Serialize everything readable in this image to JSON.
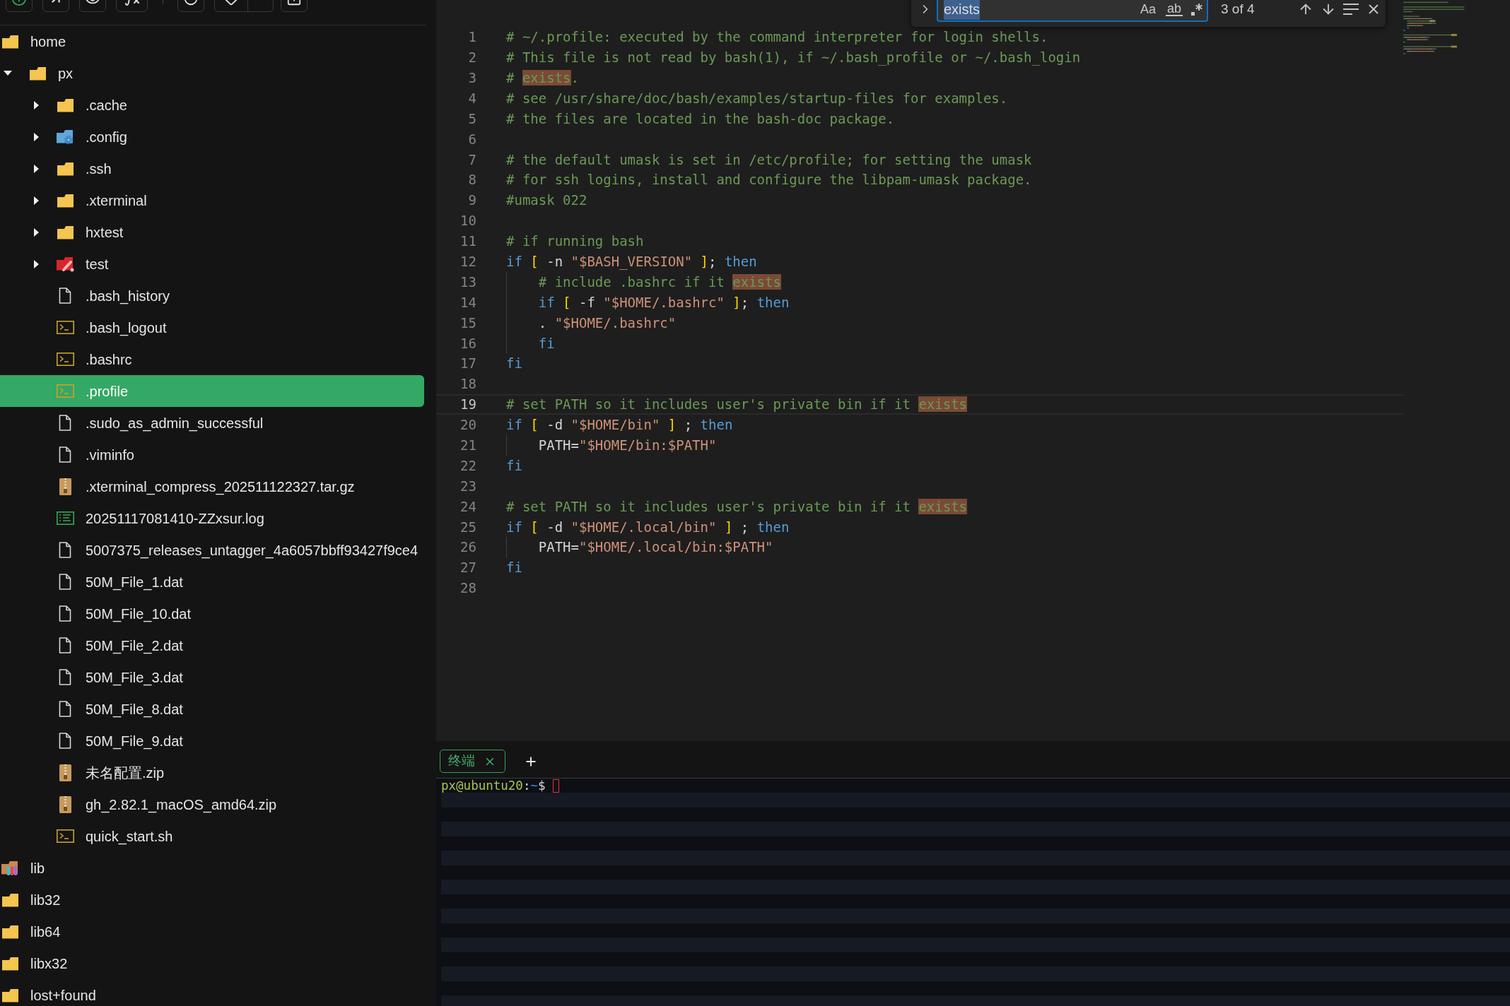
{
  "tree": [
    {
      "name": "home",
      "kind": "folder",
      "selected": false,
      "children": [
        {
          "name": "px",
          "kind": "folder",
          "expanded": true,
          "selected": false,
          "children": [
            {
              "name": ".cache",
              "kind": "folder",
              "expanded": false,
              "selected": false
            },
            {
              "name": ".config",
              "kind": "config-folder",
              "expanded": false,
              "selected": false
            },
            {
              "name": ".ssh",
              "kind": "folder",
              "expanded": false,
              "selected": false
            },
            {
              "name": ".xterminal",
              "kind": "folder",
              "expanded": false,
              "selected": false
            },
            {
              "name": "hxtest",
              "kind": "folder",
              "expanded": false,
              "selected": false
            },
            {
              "name": "test",
              "kind": "tool-folder",
              "expanded": false,
              "selected": false
            },
            {
              "name": ".bash_history",
              "kind": "file",
              "selected": false
            },
            {
              "name": ".bash_logout",
              "kind": "script",
              "selected": false
            },
            {
              "name": ".bashrc",
              "kind": "script",
              "selected": false
            },
            {
              "name": ".profile",
              "kind": "script",
              "selected": true
            },
            {
              "name": ".sudo_as_admin_successful",
              "kind": "file",
              "selected": false
            },
            {
              "name": ".viminfo",
              "kind": "file",
              "selected": false
            },
            {
              "name": ".xterminal_compress_202511122327.tar.gz",
              "kind": "archive",
              "selected": false
            },
            {
              "name": "20251117081410-ZZxsur.log",
              "kind": "log",
              "selected": false
            },
            {
              "name": "5007375_releases_untagger_4a6057bbff93427f9ce4",
              "kind": "file",
              "selected": false
            },
            {
              "name": "50M_File_1.dat",
              "kind": "file",
              "selected": false
            },
            {
              "name": "50M_File_10.dat",
              "kind": "file",
              "selected": false
            },
            {
              "name": "50M_File_2.dat",
              "kind": "file",
              "selected": false
            },
            {
              "name": "50M_File_3.dat",
              "kind": "file",
              "selected": false
            },
            {
              "name": "50M_File_8.dat",
              "kind": "file",
              "selected": false
            },
            {
              "name": "50M_File_9.dat",
              "kind": "file",
              "selected": false
            },
            {
              "name": "未名配置.zip",
              "kind": "archive",
              "selected": false
            },
            {
              "name": "gh_2.82.1_macOS_amd64.zip",
              "kind": "archive",
              "selected": false
            },
            {
              "name": "quick_start.sh",
              "kind": "script",
              "selected": false
            }
          ]
        }
      ]
    },
    {
      "name": "lib",
      "kind": "library-folder",
      "selected": false
    },
    {
      "name": "lib32",
      "kind": "folder",
      "selected": false
    },
    {
      "name": "lib64",
      "kind": "folder",
      "selected": false
    },
    {
      "name": "libx32",
      "kind": "folder",
      "selected": false
    },
    {
      "name": "lost+found",
      "kind": "folder",
      "selected": false
    }
  ],
  "editor": {
    "lines": [
      {
        "number": "1",
        "active": false,
        "indented": false,
        "tokens": [
          {
            "kind": "comment",
            "text": "# ~/.profile: executed by the command interpreter for login shells."
          }
        ]
      },
      {
        "number": "2",
        "active": false,
        "indented": false,
        "tokens": [
          {
            "kind": "comment",
            "text": "# This file is not read by bash(1), if ~/.bash_profile or ~/.bash_login"
          }
        ]
      },
      {
        "number": "3",
        "active": false,
        "indented": false,
        "tokens": [
          {
            "kind": "comment",
            "text": "# "
          },
          {
            "kind": "match",
            "text": "exists"
          },
          {
            "kind": "comment",
            "text": "."
          }
        ]
      },
      {
        "number": "4",
        "active": false,
        "indented": false,
        "tokens": [
          {
            "kind": "comment",
            "text": "# see /usr/share/doc/bash/examples/startup-files for examples."
          }
        ]
      },
      {
        "number": "5",
        "active": false,
        "indented": false,
        "tokens": [
          {
            "kind": "comment",
            "text": "# the files are located in the bash-doc package."
          }
        ]
      },
      {
        "number": "6",
        "active": false,
        "indented": false
      },
      {
        "number": "7",
        "active": false,
        "indented": false,
        "tokens": [
          {
            "kind": "comment",
            "text": "# the default umask is set in /etc/profile; for setting the umask"
          }
        ]
      },
      {
        "number": "8",
        "active": false,
        "indented": false,
        "tokens": [
          {
            "kind": "comment",
            "text": "# for ssh logins, install and configure the libpam-umask package."
          }
        ]
      },
      {
        "number": "9",
        "active": false,
        "indented": false,
        "tokens": [
          {
            "kind": "comment",
            "text": "#umask 022"
          }
        ]
      },
      {
        "number": "10",
        "active": false,
        "indented": false
      },
      {
        "number": "11",
        "active": false,
        "indented": false,
        "tokens": [
          {
            "kind": "comment",
            "text": "# if running bash"
          }
        ]
      },
      {
        "number": "12",
        "active": false,
        "indented": false,
        "tokens": [
          {
            "kind": "keyword",
            "text": "if"
          },
          {
            "kind": "bracket",
            "text": " ["
          },
          {
            "kind": "plain",
            "text": " -n "
          },
          {
            "kind": "string",
            "text": "\"$BASH_VERSION\""
          },
          {
            "kind": "bracket",
            "text": " ]"
          },
          {
            "kind": "plain",
            "text": "; "
          },
          {
            "kind": "keyword",
            "text": "then"
          }
        ]
      },
      {
        "number": "13",
        "active": false,
        "indented": true,
        "tokens": [
          {
            "kind": "comment",
            "text": "# include .bashrc if it "
          },
          {
            "kind": "match",
            "text": "exists"
          }
        ]
      },
      {
        "number": "14",
        "active": false,
        "indented": true,
        "tokens": [
          {
            "kind": "keyword",
            "text": "if"
          },
          {
            "kind": "bracket",
            "text": " ["
          },
          {
            "kind": "plain",
            "text": " -f "
          },
          {
            "kind": "string",
            "text": "\"$HOME/.bashrc\""
          },
          {
            "kind": "bracket",
            "text": " ]"
          },
          {
            "kind": "plain",
            "text": "; "
          },
          {
            "kind": "keyword",
            "text": "then"
          }
        ]
      },
      {
        "number": "15",
        "active": false,
        "indented": true,
        "tokens": [
          {
            "kind": "plain",
            "text": ". "
          },
          {
            "kind": "string",
            "text": "\"$HOME/.bashrc\""
          }
        ]
      },
      {
        "number": "16",
        "active": false,
        "indented": true,
        "tokens": [
          {
            "kind": "keyword",
            "text": "fi"
          }
        ]
      },
      {
        "number": "17",
        "active": false,
        "indented": false,
        "tokens": [
          {
            "kind": "keyword",
            "text": "fi"
          }
        ]
      },
      {
        "number": "18",
        "active": false,
        "indented": false
      },
      {
        "number": "19",
        "active": true,
        "indented": false,
        "tokens": [
          {
            "kind": "comment",
            "text": "# set PATH so it includes user's private bin if it "
          },
          {
            "kind": "match",
            "text": "exists"
          }
        ]
      },
      {
        "number": "20",
        "active": false,
        "indented": false,
        "tokens": [
          {
            "kind": "keyword",
            "text": "if"
          },
          {
            "kind": "bracket",
            "text": " ["
          },
          {
            "kind": "plain",
            "text": " -d "
          },
          {
            "kind": "string",
            "text": "\"$HOME/bin\""
          },
          {
            "kind": "bracket",
            "text": " ]"
          },
          {
            "kind": "plain",
            "text": " ; "
          },
          {
            "kind": "keyword",
            "text": "then"
          }
        ]
      },
      {
        "number": "21",
        "active": false,
        "indented": true,
        "tokens": [
          {
            "kind": "plain",
            "text": "PATH="
          },
          {
            "kind": "string",
            "text": "\"$HOME/bin:$PATH\""
          }
        ]
      },
      {
        "number": "22",
        "active": false,
        "indented": false,
        "tokens": [
          {
            "kind": "keyword",
            "text": "fi"
          }
        ]
      },
      {
        "number": "23",
        "active": false,
        "indented": false
      },
      {
        "number": "24",
        "active": false,
        "indented": false,
        "tokens": [
          {
            "kind": "comment",
            "text": "# set PATH so it includes user's private bin if it "
          },
          {
            "kind": "match",
            "text": "exists"
          }
        ]
      },
      {
        "number": "25",
        "active": false,
        "indented": false,
        "tokens": [
          {
            "kind": "keyword",
            "text": "if"
          },
          {
            "kind": "bracket",
            "text": " ["
          },
          {
            "kind": "plain",
            "text": " -d "
          },
          {
            "kind": "string",
            "text": "\"$HOME/.local/bin\""
          },
          {
            "kind": "bracket",
            "text": " ]"
          },
          {
            "kind": "plain",
            "text": " ; "
          },
          {
            "kind": "keyword",
            "text": "then"
          }
        ]
      },
      {
        "number": "26",
        "active": false,
        "indented": true,
        "tokens": [
          {
            "kind": "plain",
            "text": "PATH="
          },
          {
            "kind": "string",
            "text": "\"$HOME/.local/bin:$PATH\""
          }
        ]
      },
      {
        "number": "27",
        "active": false,
        "indented": false,
        "tokens": [
          {
            "kind": "keyword",
            "text": "fi"
          }
        ]
      },
      {
        "number": "28",
        "active": false,
        "indented": false
      }
    ]
  },
  "find": {
    "query": "exists",
    "toggles": [
      {
        "kind": "case",
        "label": "Aa"
      },
      {
        "kind": "word",
        "label": "ab"
      }
    ],
    "count": "3 of 4"
  },
  "panel": {
    "tabs": [
      {
        "label": "终端",
        "selected": true
      }
    ]
  },
  "terminal": {
    "user_host": "px@ubuntu20",
    "colon": ":",
    "path": "~",
    "symbol": "$"
  }
}
